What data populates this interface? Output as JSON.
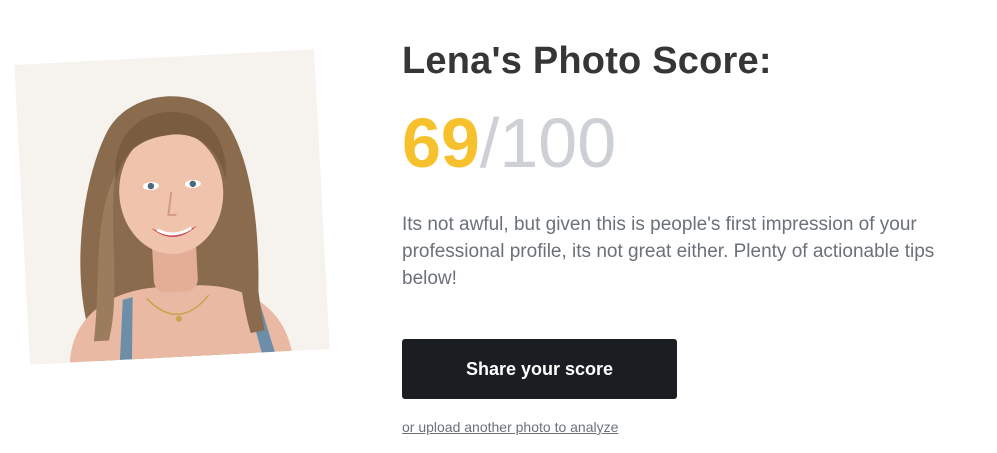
{
  "header": {
    "title": "Lena's Photo Score:"
  },
  "score": {
    "value": "69",
    "separator": "/",
    "max": "100"
  },
  "description": "Its not awful, but given this is people's first impression of your professional profile, its not great either. Plenty of actionable tips below!",
  "actions": {
    "share_label": "Share your score",
    "upload_link": "or upload another photo to analyze"
  },
  "colors": {
    "score_accent": "#f7c02d",
    "score_muted": "#cdd0d4",
    "button_bg": "#1a1d21",
    "title_text": "#343638",
    "body_text": "#6b7178"
  }
}
